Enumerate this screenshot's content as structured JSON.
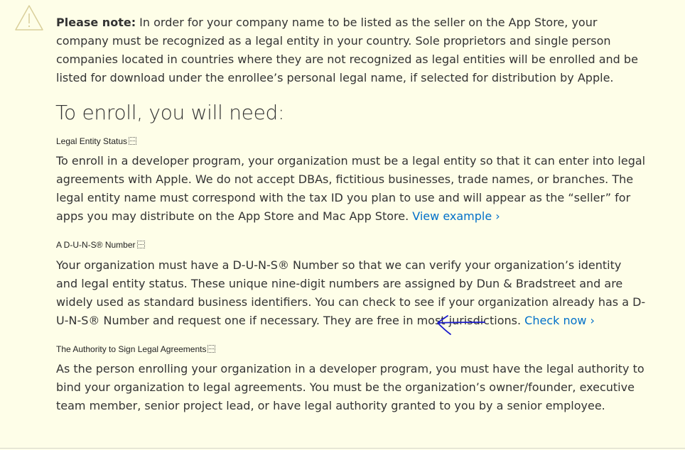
{
  "note": {
    "label": "Please note:",
    "text": " In order for your company name to be listed as the seller on the App Store, your company must be recognized as a legal entity in your country. Sole proprietors and single person companies located in countries where they are not recognized as legal entities will be enrolled and be listed for download under the enrollee’s personal legal name, if selected for distribution by Apple."
  },
  "heading": "To enroll, you will need:",
  "sections": [
    {
      "title": "Legal Entity Status",
      "text": "To enroll in a developer program, your organization must be a legal entity so that it can enter into legal agreements with Apple. We do not accept DBAs, fictitious businesses, trade names, or branches. The legal entity name must correspond with the tax ID you plan to use and will appear as the “seller” for apps you may distribute on the App Store and Mac App Store. ",
      "link": "View example ›"
    },
    {
      "title": "A D-U-N-S® Number",
      "text": "Your organization must have a D-U-N-S® Number so that we can verify your organization’s identity and legal entity status. These unique nine-digit numbers are assigned by Dun & Bradstreet and are widely used as standard business identifiers. You can check to see if your organization already has a D-U-N-S® Number and request one if necessary. They are free in most jurisdictions. ",
      "link": "Check now ›"
    },
    {
      "title": "The Authority to Sign Legal Agreements",
      "text": "As the person enrolling your organization in a developer program, you must have the legal authority to bind your organization to legal agreements. You must be the organization’s owner/founder, executive team member, senior project lead, or have legal authority granted to you by a senior employee."
    }
  ],
  "icons": {
    "warning": "warning-icon",
    "annotation": "hand-drawn-arrow-icon"
  },
  "colors": {
    "background": "#fefee8",
    "text": "#333333",
    "link": "#0070c9",
    "annotation": "#1a1acd"
  }
}
